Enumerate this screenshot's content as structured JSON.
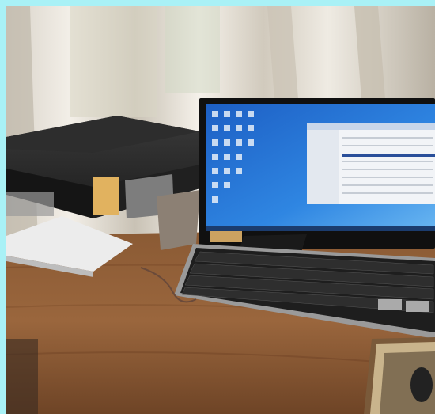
{
  "scene": {
    "description_tag": "desk-with-printer-and-computer",
    "border_color": "#a9f1f6"
  },
  "objects": {
    "window": "window-curtains",
    "printer": "black-multifunction-printer",
    "monitor": "widescreen-monitor",
    "screen": "windows-desktop-screen",
    "keyboard": "keyboard",
    "desk": "wooden-desk",
    "mousepad": "patterned-mousepad"
  }
}
